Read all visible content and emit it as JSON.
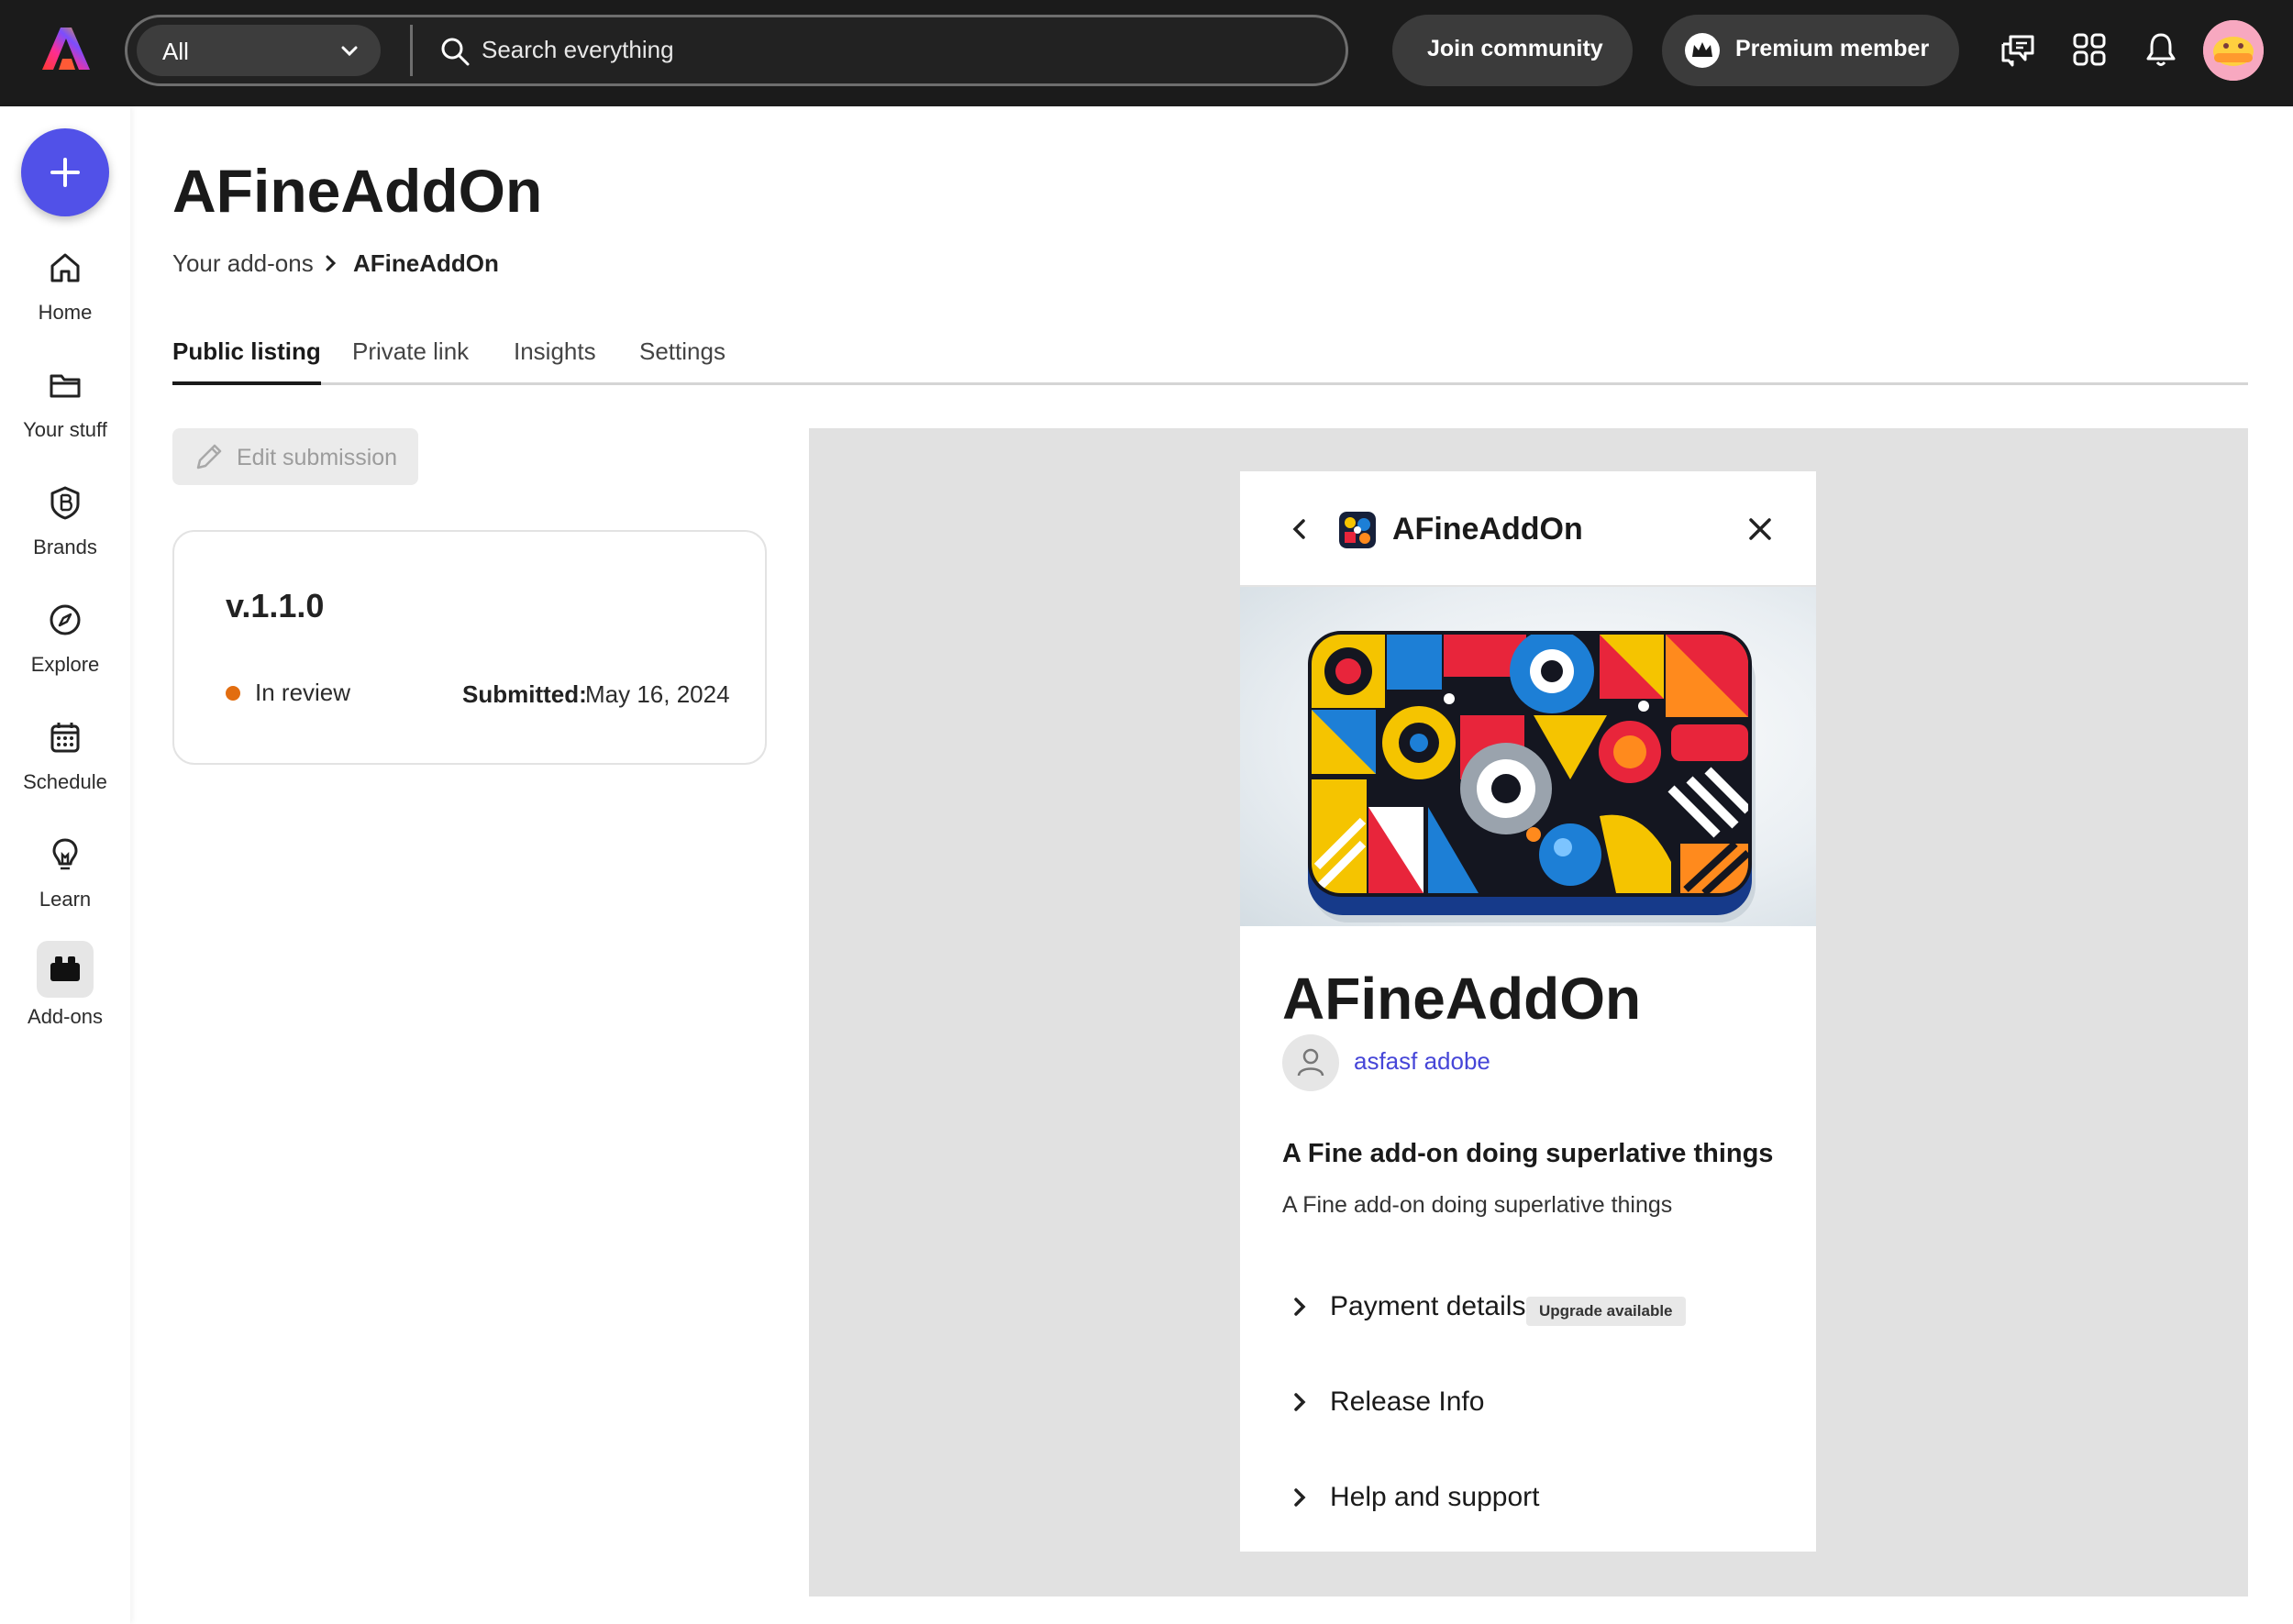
{
  "topbar": {
    "search_scope": "All",
    "search_placeholder": "Search everything",
    "join_label": "Join community",
    "premium_label": "Premium member",
    "icons": [
      "adobe-logo-icon",
      "chat-icon",
      "apps-grid-icon",
      "bell-icon"
    ]
  },
  "sidebar": {
    "items": [
      {
        "label": "Home",
        "icon": "home-icon"
      },
      {
        "label": "Your stuff",
        "icon": "folder-icon"
      },
      {
        "label": "Brands",
        "icon": "brand-icon"
      },
      {
        "label": "Explore",
        "icon": "compass-icon"
      },
      {
        "label": "Schedule",
        "icon": "calendar-icon"
      },
      {
        "label": "Learn",
        "icon": "lightbulb-icon"
      },
      {
        "label": "Add-ons",
        "icon": "addons-icon",
        "active": true
      }
    ]
  },
  "page": {
    "title": "AFineAddOn",
    "breadcrumb": [
      "Your add-ons",
      "AFineAddOn"
    ],
    "tabs": [
      "Public listing",
      "Private link",
      "Insights",
      "Settings"
    ],
    "active_tab": "Public listing",
    "edit_label": "Edit submission"
  },
  "submission": {
    "version": "v.1.1.0",
    "status": "In review",
    "submitted_label": "Submitted:",
    "submitted_date": "May 16, 2024"
  },
  "preview": {
    "header_title": "AFineAddOn",
    "name": "AFineAddOn",
    "author": "asfasf adobe",
    "subtitle": "A Fine add-on doing superlative things",
    "description": "A Fine add-on doing superlative things",
    "sections": [
      {
        "label": "Payment details",
        "badge": "Upgrade available"
      },
      {
        "label": "Release Info"
      },
      {
        "label": "Help and support"
      }
    ]
  },
  "colors": {
    "topbar_bg": "#1b1b1b",
    "accent": "#5151e8",
    "link": "#4646d8",
    "status_in_review": "#e26d10"
  }
}
